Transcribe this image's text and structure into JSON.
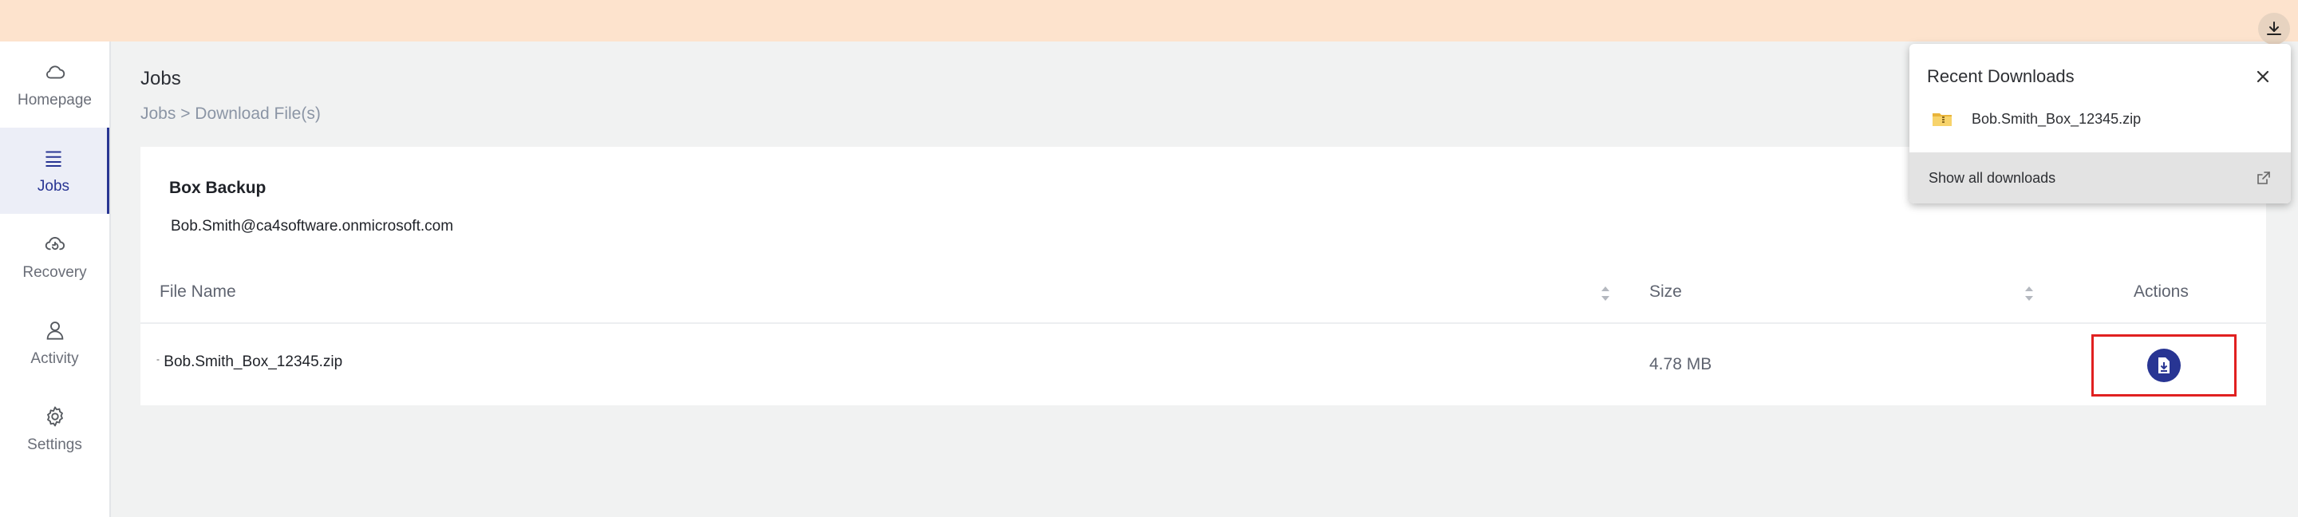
{
  "sidebar": {
    "items": [
      {
        "label": "Homepage",
        "icon": "cloud-icon",
        "active": false
      },
      {
        "label": "Jobs",
        "icon": "list-icon",
        "active": true
      },
      {
        "label": "Recovery",
        "icon": "cloud-restore-icon",
        "active": false
      },
      {
        "label": "Activity",
        "icon": "person-icon",
        "active": false
      },
      {
        "label": "Settings",
        "icon": "gear-icon",
        "active": false
      }
    ]
  },
  "header": {
    "title": "Jobs",
    "breadcrumb": "Jobs > Download File(s)"
  },
  "job": {
    "name": "Box Backup",
    "email": "Bob.Smith@ca4software.onmicrosoft.com"
  },
  "table": {
    "columns": [
      "File Name",
      "Size",
      "Actions"
    ],
    "rows": [
      {
        "file_name": "Bob.Smith_Box_12345.zip",
        "size": "4.78 MB"
      }
    ]
  },
  "downloads_popup": {
    "title": "Recent Downloads",
    "items": [
      {
        "file_name": "Bob.Smith_Box_12345.zip",
        "icon": "zip-folder-icon"
      }
    ],
    "footer_label": "Show all downloads"
  },
  "colors": {
    "banner": "#fde3cd",
    "accent": "#283593",
    "highlight_border": "#e02020"
  }
}
